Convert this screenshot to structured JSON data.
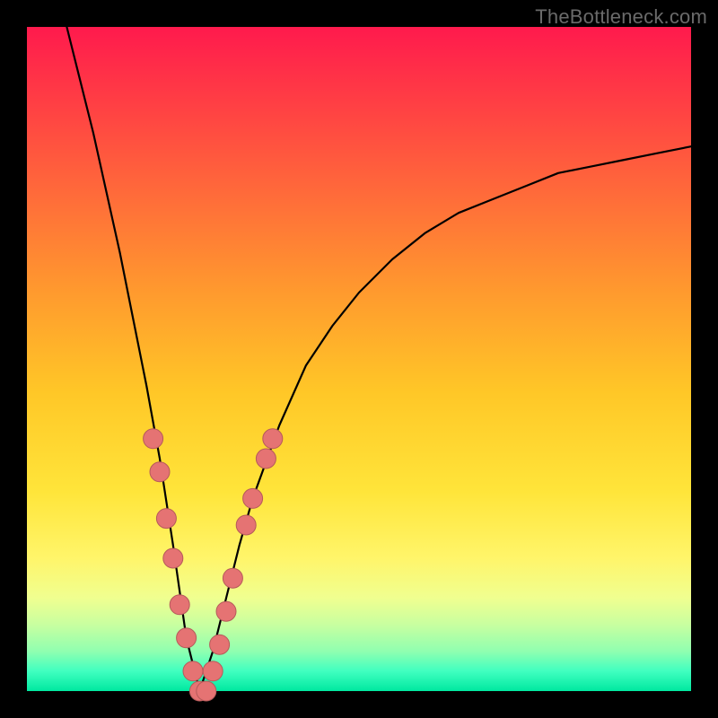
{
  "watermark": "TheBottleneck.com",
  "colors": {
    "frame": "#000000",
    "curve": "#000000",
    "marker_fill": "#e57373",
    "marker_stroke": "#b55a5a"
  },
  "chart_data": {
    "type": "line",
    "title": "",
    "xlabel": "",
    "ylabel": "",
    "xlim": [
      0,
      100
    ],
    "ylim": [
      0,
      100
    ],
    "note": "V-shaped bottleneck curve. y≈0 at the optimum (~x≈26); rises sharply on both sides. Left branch starts at top-left frame; right branch rises toward upper-right. Values estimated from pixel positions (no axis ticks present).",
    "series": [
      {
        "name": "curve",
        "x": [
          6,
          8,
          10,
          12,
          14,
          16,
          18,
          20,
          22,
          24,
          26,
          28,
          30,
          32,
          34,
          38,
          42,
          46,
          50,
          55,
          60,
          65,
          70,
          75,
          80,
          85,
          90,
          95,
          100
        ],
        "y": [
          100,
          92,
          84,
          75,
          66,
          56,
          46,
          35,
          22,
          8,
          0,
          6,
          14,
          22,
          29,
          40,
          49,
          55,
          60,
          65,
          69,
          72,
          74,
          76,
          78,
          79,
          80,
          81,
          82
        ]
      }
    ],
    "markers": {
      "name": "highlighted-points",
      "note": "salmon-colored circular markers clustered near the bottom of the V on both branches",
      "points": [
        {
          "x": 19,
          "y": 38
        },
        {
          "x": 20,
          "y": 33
        },
        {
          "x": 21,
          "y": 26
        },
        {
          "x": 22,
          "y": 20
        },
        {
          "x": 23,
          "y": 13
        },
        {
          "x": 24,
          "y": 8
        },
        {
          "x": 25,
          "y": 3
        },
        {
          "x": 26,
          "y": 0
        },
        {
          "x": 27,
          "y": 0
        },
        {
          "x": 28,
          "y": 3
        },
        {
          "x": 29,
          "y": 7
        },
        {
          "x": 30,
          "y": 12
        },
        {
          "x": 31,
          "y": 17
        },
        {
          "x": 33,
          "y": 25
        },
        {
          "x": 34,
          "y": 29
        },
        {
          "x": 36,
          "y": 35
        },
        {
          "x": 37,
          "y": 38
        }
      ]
    }
  }
}
